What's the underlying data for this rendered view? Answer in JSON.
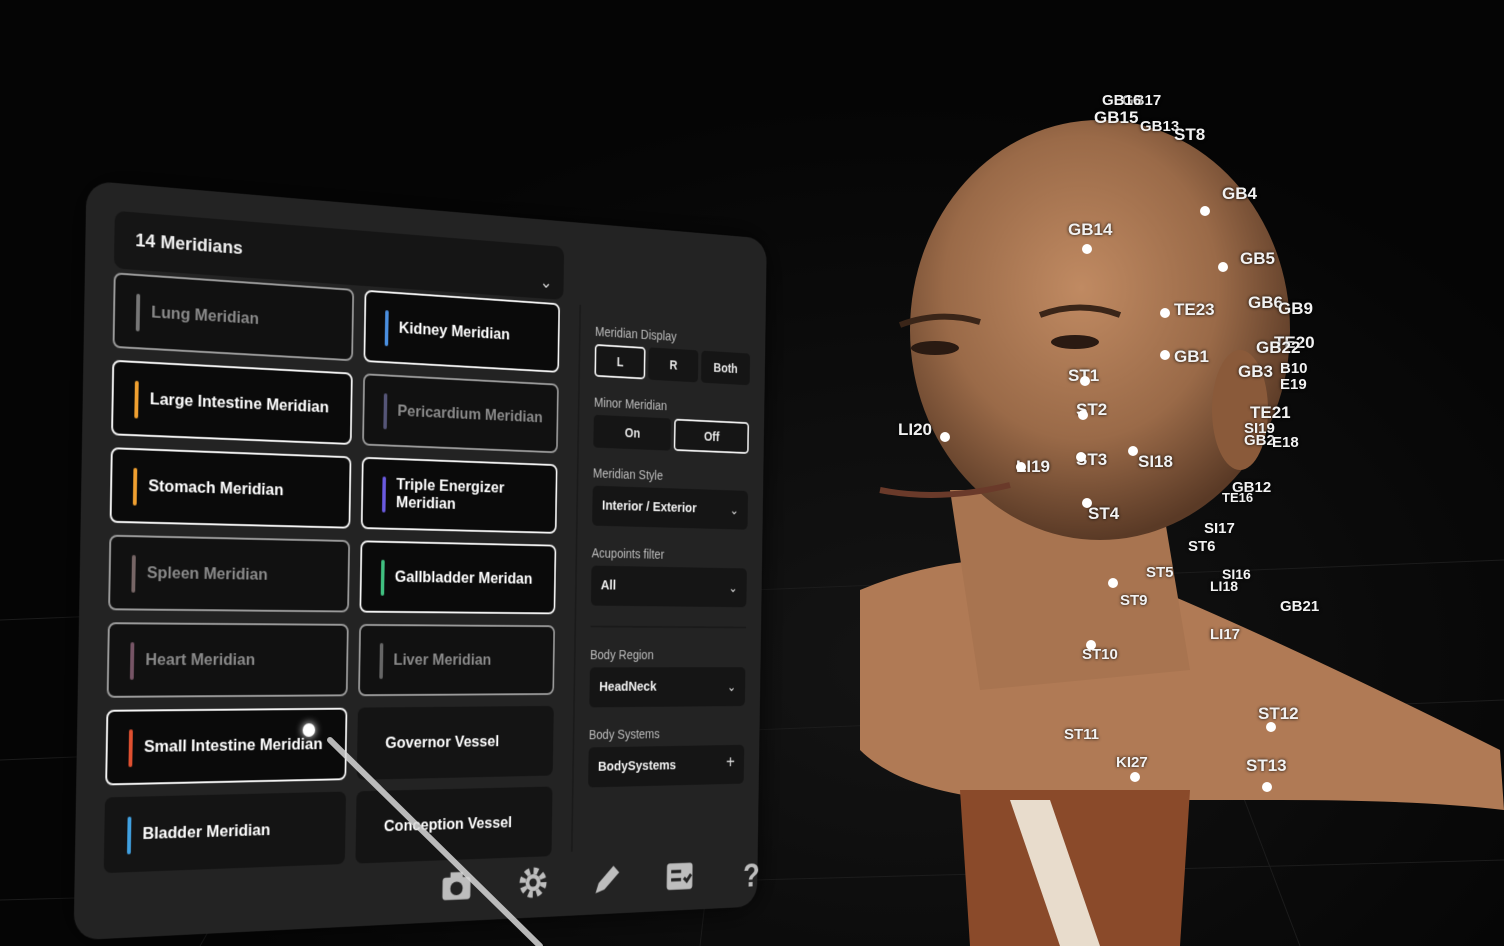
{
  "panel": {
    "title": "14 Meridians",
    "meridians": [
      {
        "label": "Lung Meridian",
        "color": "#777777",
        "state": "dim"
      },
      {
        "label": "Kidney Meridian",
        "color": "#4a8fe0",
        "state": "active"
      },
      {
        "label": "Large Intestine Meridian",
        "color": "#f0a030",
        "state": "active"
      },
      {
        "label": "Pericardium Meridian",
        "color": "#555577",
        "state": "dim"
      },
      {
        "label": "Stomach Meridian",
        "color": "#f0a030",
        "state": "active"
      },
      {
        "label": "Triple Energizer Meridian",
        "color": "#6a5ae0",
        "state": "active"
      },
      {
        "label": "Spleen Meridian",
        "color": "#776666",
        "state": "dim"
      },
      {
        "label": "Gallbladder Meridan",
        "color": "#40c080",
        "state": "active"
      },
      {
        "label": "Heart Meridian",
        "color": "#775566",
        "state": "dim"
      },
      {
        "label": "Liver Meridian",
        "color": "#666666",
        "state": "dim"
      },
      {
        "label": "Small Intestine Meridian",
        "color": "#e05030",
        "state": "active"
      },
      {
        "label": "Governor Vessel",
        "color": "",
        "state": "plain"
      },
      {
        "label": "Bladder Meridian",
        "color": "#40a0e0",
        "state": "plain"
      },
      {
        "label": "Conception Vessel",
        "color": "",
        "state": "plain"
      }
    ],
    "meridian_display": {
      "label": "Meridian Display",
      "options": [
        "L",
        "R",
        "Both"
      ],
      "selected": "L"
    },
    "minor_meridian": {
      "label": "Minor Meridian",
      "options": [
        "On",
        "Off"
      ],
      "selected": "Off"
    },
    "meridian_style": {
      "label": "Meridian Style",
      "value": "Interior / Exterior"
    },
    "acupoints_filter": {
      "label": "Acupoints filter",
      "value": "All"
    },
    "body_region": {
      "label": "Body Region",
      "value": "HeadNeck"
    },
    "body_systems": {
      "label": "Body Systems",
      "value": "BodySystems"
    },
    "toolbar": [
      "camera-icon",
      "gear-icon",
      "pen-icon",
      "checklist-icon",
      "help-icon"
    ]
  },
  "acupoints": [
    "GB17",
    "GB16",
    "GB15",
    "GB13",
    "ST8",
    "GB4",
    "GB14",
    "GB5",
    "GB6",
    "GB9",
    "TE23",
    "TE20",
    "GB22",
    "GB1",
    "GB3",
    "B10",
    "E19",
    "ST1",
    "ST2",
    "TE21",
    "SI19",
    "GB2",
    "E18",
    "LI20",
    "LI19",
    "ST3",
    "SI18",
    "GB12",
    "TE16",
    "ST4",
    "SI17",
    "ST6",
    "ST5",
    "SI16",
    "LI18",
    "ST9",
    "GB21",
    "LI17",
    "ST10",
    "ST12",
    "ST11",
    "KI27",
    "ST13"
  ]
}
